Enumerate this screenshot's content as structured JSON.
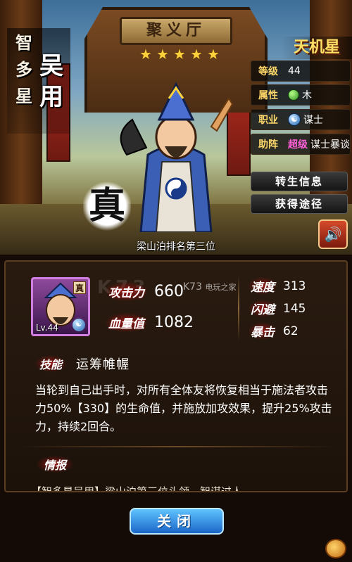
{
  "scene": {
    "gate_plaque": "聚义厅",
    "rank_text": "梁山泊排名第三位",
    "seal_char": "真"
  },
  "hero": {
    "epithet_chars": "智多星",
    "name_chars": "吴用",
    "star_name": "天机星",
    "stars": 5
  },
  "info": {
    "rows": [
      {
        "key": "等级",
        "value": "44"
      },
      {
        "key": "属性",
        "value": "木",
        "icon": "wood-gem-icon"
      },
      {
        "key": "职业",
        "value": "谋士",
        "icon": "taiji-icon"
      },
      {
        "key": "助阵",
        "highlight": "超级",
        "value": "谋士暴谈"
      }
    ],
    "buttons": [
      "转生信息",
      "获得途径"
    ]
  },
  "card": {
    "level": "Lv.44",
    "badge": "真",
    "stats": [
      {
        "label": "攻击力",
        "value": "660"
      },
      {
        "label": "血量值",
        "value": "1082"
      }
    ],
    "sub_stats": [
      {
        "label": "速度",
        "value": "313"
      },
      {
        "label": "闪避",
        "value": "145"
      },
      {
        "label": "暴击",
        "value": "62"
      }
    ],
    "watermark": "K73",
    "watermark_sub": "电玩之家"
  },
  "skill": {
    "tag": "技能",
    "name": "运筹帷幄",
    "description": "当轮到自己出手时，对所有全体友将恢复相当于施法者攻击力50%【330】的生命值，并施放加攻效果，提升25%攻击力，持续2回合。"
  },
  "bio": {
    "tag": "情报",
    "line": "【智多星吴用】梁山泊第三位头领，智谋过人……"
  },
  "footer": {
    "close_label": "关闭"
  },
  "colors": {
    "accent_gold": "#ffd86a",
    "super_pink": "#ff5fd8",
    "close_blue": "#1b66c8"
  }
}
